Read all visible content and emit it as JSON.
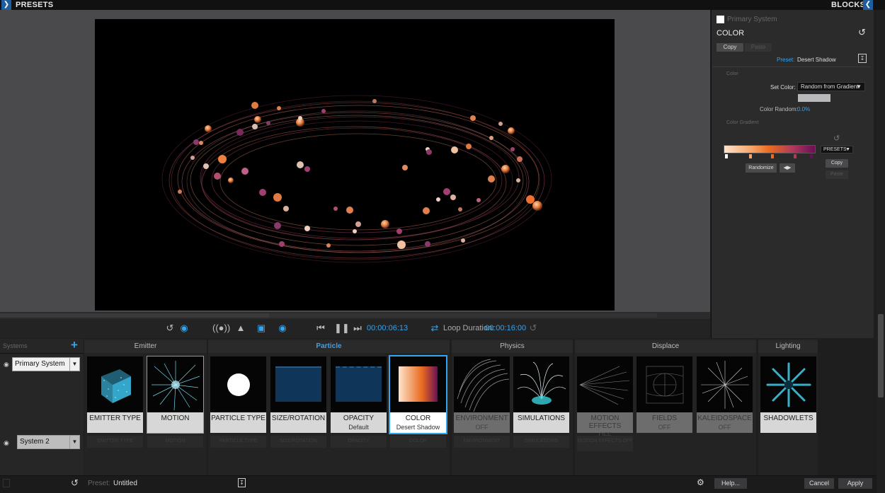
{
  "topbar": {
    "left_label": "PRESETS",
    "right_label": "BLOCKS"
  },
  "playbar": {
    "current_time": "00:00:06:13",
    "loop_label": "Loop Duration:",
    "loop_duration": "00:00:16:00"
  },
  "right_panel": {
    "system_name": "Primary System",
    "section_title": "COLOR",
    "copy_label": "Copy",
    "paste_label": "Paste",
    "preset_label": "Preset:",
    "preset_value": "Desert Shadow",
    "color_group_label": "Color",
    "set_color_label": "Set Color:",
    "set_color_value": "Random from Gradient",
    "color_random_label": "Color Random:",
    "color_random_value": "0.0%",
    "gradient_group_label": "Color Gradient",
    "gradient_presets_label": "PRESETS",
    "gradient_copy_label": "Copy",
    "gradient_paste_label": "Paste",
    "randomize_label": "Randomize",
    "colors": {
      "accent": "#34a4ee",
      "swatch": "#b9b9bb"
    }
  },
  "systems": {
    "header": "Systems",
    "items": [
      {
        "name": "Primary System"
      },
      {
        "name": "System 2"
      }
    ]
  },
  "categories": {
    "emitter": "Emitter",
    "particle": "Particle",
    "physics": "Physics",
    "displace": "Displace",
    "lighting": "Lighting"
  },
  "blocks": {
    "emitter_type": {
      "label": "EMITTER TYPE"
    },
    "motion": {
      "label": "MOTION"
    },
    "particle_type": {
      "label": "PARTICLE TYPE"
    },
    "size_rotation": {
      "label": "SIZE/ROTATION"
    },
    "opacity": {
      "label": "OPACITY",
      "sub": "Default"
    },
    "color": {
      "label": "COLOR",
      "sub": "Desert Shadow"
    },
    "environment": {
      "label": "ENVIRONMENT",
      "sub": "OFF"
    },
    "simulations": {
      "label": "SIMULATIONS"
    },
    "motion_effects": {
      "label": "MOTION EFFECTS",
      "sub": "OFF"
    },
    "fields": {
      "label": "FIELDS",
      "sub": "OFF"
    },
    "kaleidospace": {
      "label": "KALEIDOSPACE",
      "sub": "OFF"
    },
    "shadowlets": {
      "label": "SHADOWLETS"
    }
  },
  "ghost_blocks": {
    "emitter_type": "EMITTER TYPE",
    "motion": "MOTION",
    "particle_type": "PARTICLE TYPE",
    "size_rotation": "SIZE/ROTATION",
    "opacity": "OPACITY",
    "color": "COLOR",
    "environment": "ENVIRONMENT",
    "simulations": "SIMULATIONS",
    "motion_effects": "MOTION EFFECTS OFF"
  },
  "bottom_bar": {
    "preset_label": "Preset:",
    "preset_value": "Untitled",
    "help_label": "Help...",
    "cancel_label": "Cancel",
    "apply_label": "Apply"
  }
}
